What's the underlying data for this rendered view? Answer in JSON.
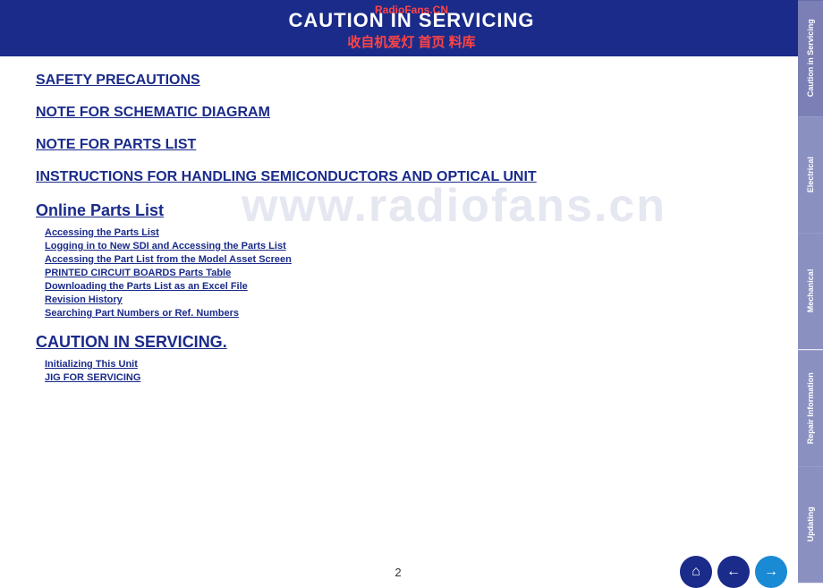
{
  "header": {
    "watermark_top": "RadioFans.CN",
    "title": "CAUTION IN SERVICING",
    "subtitle": "收自机爱灯 首页 料库"
  },
  "sidebar": {
    "tabs": [
      {
        "id": "caution",
        "label": "Caution in Servicing",
        "active": true
      },
      {
        "id": "electrical",
        "label": "Electrical",
        "active": false
      },
      {
        "id": "mechanical",
        "label": "Mechanical",
        "active": false
      },
      {
        "id": "repair",
        "label": "Repair Information",
        "active": false
      },
      {
        "id": "updating",
        "label": "Updating",
        "active": false
      }
    ]
  },
  "main": {
    "links": [
      {
        "id": "safety",
        "label": "SAFETY PRECAUTIONS"
      },
      {
        "id": "schematic",
        "label": "NOTE FOR SCHEMATIC DIAGRAM"
      },
      {
        "id": "parts-list",
        "label": "NOTE FOR PARTS LIST"
      },
      {
        "id": "semiconductors",
        "label": "INSTRUCTIONS FOR HANDLING SEMICONDUCTORS AND OPTICAL UNIT"
      }
    ],
    "online_parts": {
      "title": "Online Parts List",
      "sub_links": [
        "Accessing the Parts List",
        "Logging in to New SDI and Accessing the Parts List",
        "Accessing the Part List from the Model Asset Screen",
        "PRINTED CIRCUIT BOARDS Parts Table",
        "Downloading the Parts List as an Excel File",
        "Revision History",
        "Searching Part Numbers or Ref. Numbers"
      ]
    },
    "caution_servicing": {
      "title": "CAUTION IN SERVICING.",
      "sub_links": [
        "Initializing This Unit",
        "JIG FOR SERVICING"
      ]
    }
  },
  "watermark": "www.radiofans.cn",
  "footer": {
    "page_number": "2",
    "buttons": {
      "home": "⌂",
      "back": "←",
      "next": "→"
    }
  }
}
